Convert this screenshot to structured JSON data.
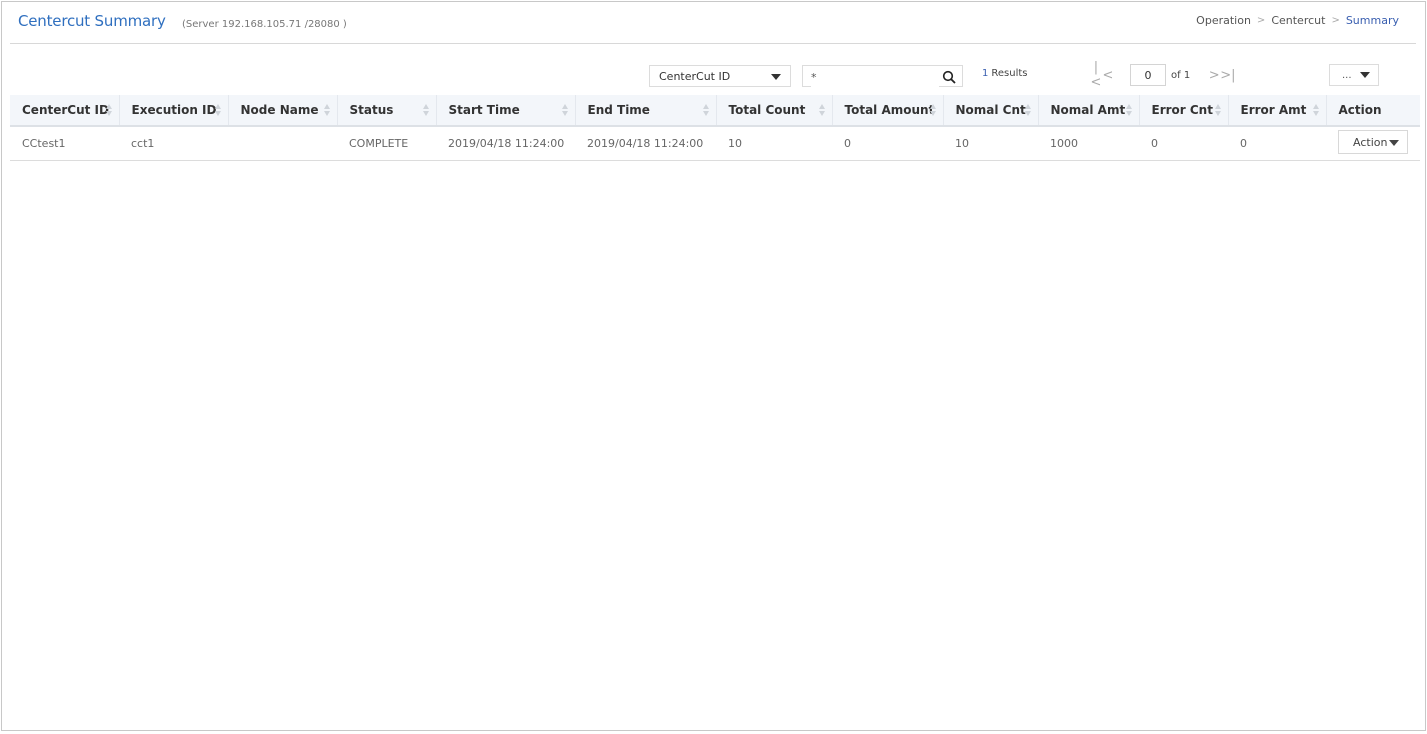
{
  "header": {
    "title": "Centercut Summary",
    "server": "(Server 192.168.105.71 /28080 )",
    "breadcrumb": [
      "Operation",
      "Centercut",
      "Summary"
    ],
    "breadcrumb_separator": ">"
  },
  "toolbar": {
    "filter_select": "CenterCut ID",
    "search_value": "*",
    "results_count": "1",
    "results_label": "Results",
    "page_current": "0",
    "page_of": "of 1",
    "more_label": "..."
  },
  "table": {
    "columns": [
      "CenterCut ID",
      "Execution ID",
      "Node Name",
      "Status",
      "Start Time",
      "End Time",
      "Total Count",
      "Total Amount",
      "Nomal Cnt",
      "Nomal Amt",
      "Error Cnt",
      "Error Amt",
      "Action"
    ],
    "rows": [
      {
        "centercut_id": "CCtest1",
        "execution_id": "cct1",
        "node_name": "",
        "status": "COMPLETE",
        "start_time": "2019/04/18 11:24:00",
        "end_time": "2019/04/18 11:24:00",
        "total_count": "10",
        "total_amount": "0",
        "nomal_cnt": "10",
        "nomal_amt": "1000",
        "error_cnt": "0",
        "error_amt": "0",
        "action_label": "Action"
      }
    ]
  },
  "colors": {
    "title": "#2f6fbf",
    "breadcrumb_current": "#3a5fb0",
    "header_bg": "#f3f6fa"
  }
}
